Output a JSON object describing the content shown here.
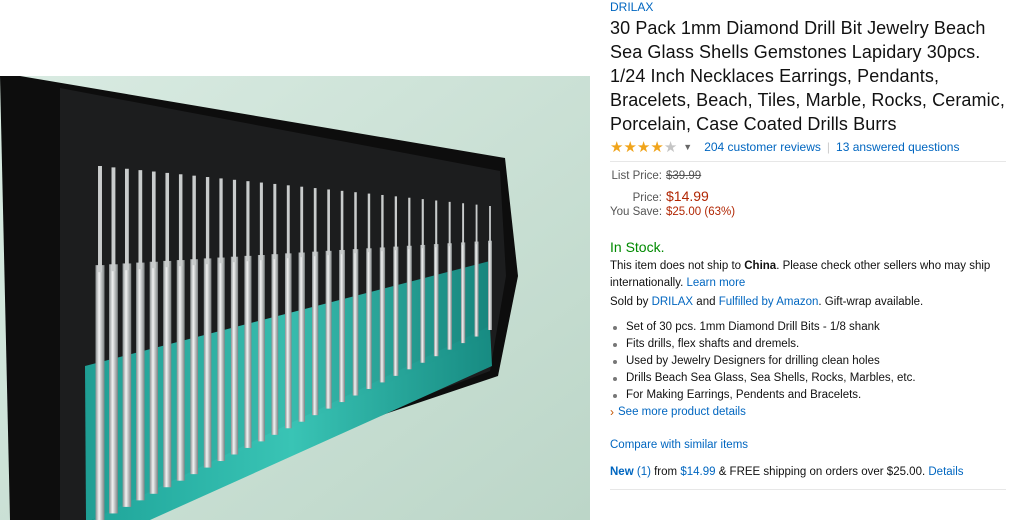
{
  "product": {
    "brand": "DRILAX",
    "title": "30 Pack 1mm Diamond Drill Bit Jewelry Beach Sea Glass Shells Gemstones Lapidary 30pcs. 1/24 Inch Necklaces Earrings, Pendants, Bracelets, Beach, Tiles, Marble, Rocks, Ceramic, Porcelain, Case Coated Drills Burrs",
    "rating": 4,
    "rating_max": 5,
    "reviews_label": "204 customer reviews",
    "answered_label": "13 answered questions"
  },
  "pricing": {
    "list_price_label": "List Price:",
    "list_price": "$39.99",
    "price_label": "Price:",
    "price": "$14.99",
    "save_label": "You Save:",
    "save_value": "$25.00 (63%)"
  },
  "availability": {
    "stock": "In Stock.",
    "ship_prefix": "This item does not ship to ",
    "ship_country": "China",
    "ship_suffix": ". Please check other sellers who may ship internationally. ",
    "learn_more": "Learn more",
    "sold_by_prefix": "Sold by ",
    "seller": "DRILAX",
    "and": " and ",
    "fulfilled": "Fulfilled by Amazon",
    "giftwrap": ". Gift-wrap available."
  },
  "bullets": [
    "Set of 30 pcs. 1mm Diamond Drill Bits - 1/8 shank",
    "Fits drills, flex shafts and dremels.",
    "Used by Jewelry Designers for drilling clean holes",
    "Drills Beach Sea Glass, Sea Shells, Rocks, Marbles, etc.",
    "For Making Earrings, Pendents and Bracelets."
  ],
  "see_more": "See more product details",
  "compare": "Compare with similar items",
  "offers": {
    "new_label": "New",
    "count": "(1)",
    "from_text": " from ",
    "from_price": "$14.99",
    "shipping_text": " & FREE shipping on orders over $25.00. ",
    "details": "Details"
  },
  "colors": {
    "link": "#0066c0",
    "price": "#b12704",
    "stock": "#008a00",
    "star": "#f0a41b"
  }
}
